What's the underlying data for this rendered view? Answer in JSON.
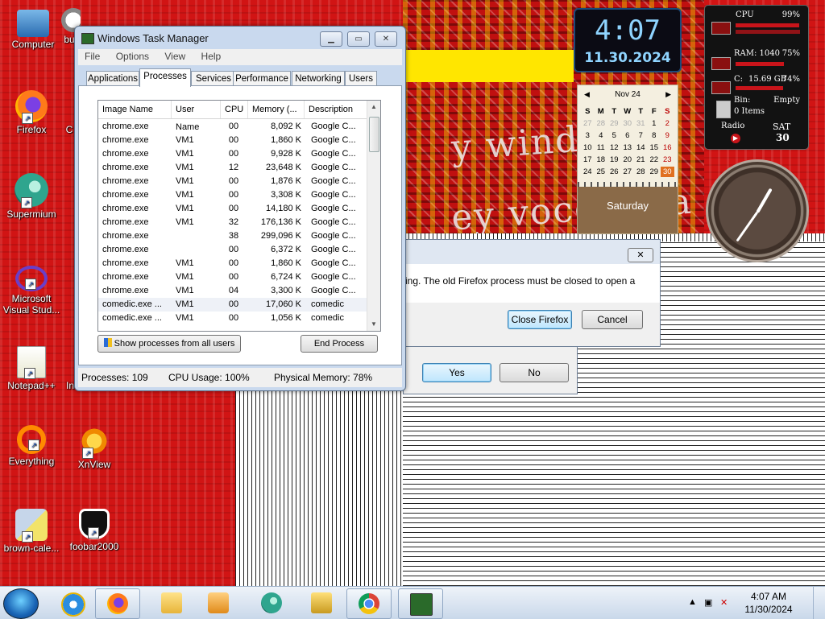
{
  "desktop": {
    "glitch_line1": "y windows",
    "glitch_line2": "ey vocogle a",
    "icons": [
      {
        "label": "Computer"
      },
      {
        "label": "bu"
      },
      {
        "label": "Firefox"
      },
      {
        "label": "C"
      },
      {
        "label": "Supermium"
      },
      {
        "label": "Microsoft Visual Stud..."
      },
      {
        "label": "Notepad++"
      },
      {
        "label": "In"
      },
      {
        "label": "Everything"
      },
      {
        "label": "XnView"
      },
      {
        "label": "brown-cale..."
      },
      {
        "label": "foobar2000"
      }
    ]
  },
  "task_manager": {
    "title": "Windows Task Manager",
    "menu": [
      "File",
      "Options",
      "View",
      "Help"
    ],
    "tabs": [
      "Applications",
      "Processes",
      "Services",
      "Performance",
      "Networking",
      "Users"
    ],
    "active_tab": "Processes",
    "columns": [
      "Image Name",
      "User Name",
      "CPU",
      "Memory (...",
      "Description"
    ],
    "rows": [
      {
        "name": "chrome.exe",
        "user": "",
        "cpu": "00",
        "mem": "8,092 K",
        "desc": "Google C..."
      },
      {
        "name": "chrome.exe",
        "user": "VM1",
        "cpu": "00",
        "mem": "1,860 K",
        "desc": "Google C..."
      },
      {
        "name": "chrome.exe",
        "user": "VM1",
        "cpu": "00",
        "mem": "9,928 K",
        "desc": "Google C..."
      },
      {
        "name": "chrome.exe",
        "user": "VM1",
        "cpu": "12",
        "mem": "23,648 K",
        "desc": "Google C..."
      },
      {
        "name": "chrome.exe",
        "user": "VM1",
        "cpu": "00",
        "mem": "1,876 K",
        "desc": "Google C..."
      },
      {
        "name": "chrome.exe",
        "user": "VM1",
        "cpu": "00",
        "mem": "3,308 K",
        "desc": "Google C..."
      },
      {
        "name": "chrome.exe",
        "user": "VM1",
        "cpu": "00",
        "mem": "14,180 K",
        "desc": "Google C..."
      },
      {
        "name": "chrome.exe",
        "user": "VM1",
        "cpu": "32",
        "mem": "176,136 K",
        "desc": "Google C..."
      },
      {
        "name": "chrome.exe",
        "user": "",
        "cpu": "38",
        "mem": "299,096 K",
        "desc": "Google C..."
      },
      {
        "name": "chrome.exe",
        "user": "",
        "cpu": "00",
        "mem": "6,372 K",
        "desc": "Google C..."
      },
      {
        "name": "chrome.exe",
        "user": "VM1",
        "cpu": "00",
        "mem": "1,860 K",
        "desc": "Google C..."
      },
      {
        "name": "chrome.exe",
        "user": "VM1",
        "cpu": "00",
        "mem": "6,724 K",
        "desc": "Google C..."
      },
      {
        "name": "chrome.exe",
        "user": "VM1",
        "cpu": "04",
        "mem": "3,300 K",
        "desc": "Google C..."
      },
      {
        "name": "comedic.exe ...",
        "user": "VM1",
        "cpu": "00",
        "mem": "17,060 K",
        "desc": "comedic"
      },
      {
        "name": "comedic.exe ...",
        "user": "VM1",
        "cpu": "00",
        "mem": "1,056 K",
        "desc": "comedic"
      }
    ],
    "show_all_label": "Show processes from all users",
    "end_process_label": "End Process",
    "status": {
      "processes": "Processes: 109",
      "cpu": "CPU Usage: 100%",
      "memory": "Physical Memory: 78%"
    }
  },
  "firefox_dialog": {
    "message": "ing. The old Firefox process must be closed to open a",
    "close_label": "Close Firefox",
    "cancel_label": "Cancel"
  },
  "confirm_dialog": {
    "yes_label": "Yes",
    "no_label": "No"
  },
  "clock_gadget": {
    "time": "4:07",
    "date": "11.30.2024"
  },
  "calendar_gadget": {
    "month": "Nov 24",
    "weekdays": [
      "S",
      "M",
      "T",
      "W",
      "T",
      "F",
      "S"
    ],
    "weeks": [
      [
        "27",
        "28",
        "29",
        "30",
        "31",
        "1",
        "2"
      ],
      [
        "3",
        "4",
        "5",
        "6",
        "7",
        "8",
        "9"
      ],
      [
        "10",
        "11",
        "12",
        "13",
        "14",
        "15",
        "16"
      ],
      [
        "17",
        "18",
        "19",
        "20",
        "21",
        "22",
        "23"
      ],
      [
        "24",
        "25",
        "26",
        "27",
        "28",
        "29",
        "30"
      ]
    ],
    "today": "30",
    "day_name": "Saturday"
  },
  "meter_gadget": {
    "cpu_label": "CPU",
    "cpu_value": "99%",
    "ram_label": "RAM: 1040",
    "ram_value": "75%",
    "disk_label": "C:",
    "disk_size": "15.69 GB",
    "disk_value": "74%",
    "bin_label": "Bin:",
    "bin_state": "Empty",
    "bin_items": "0 Items",
    "radio_label": "Radio",
    "day": "SAT",
    "date": "30",
    "cpu_fraction": 0.99,
    "ram_fraction": 0.75,
    "disk_fraction": 0.74,
    "accent": "#c8141a"
  },
  "taskbar": {
    "apps": [
      "Internet Explorer",
      "Firefox",
      "Explorer",
      "Media Player",
      "Supermium",
      "Installer",
      "Chrome",
      "Task Manager"
    ],
    "tray_time": "4:07 AM",
    "tray_date": "11/30/2024"
  }
}
